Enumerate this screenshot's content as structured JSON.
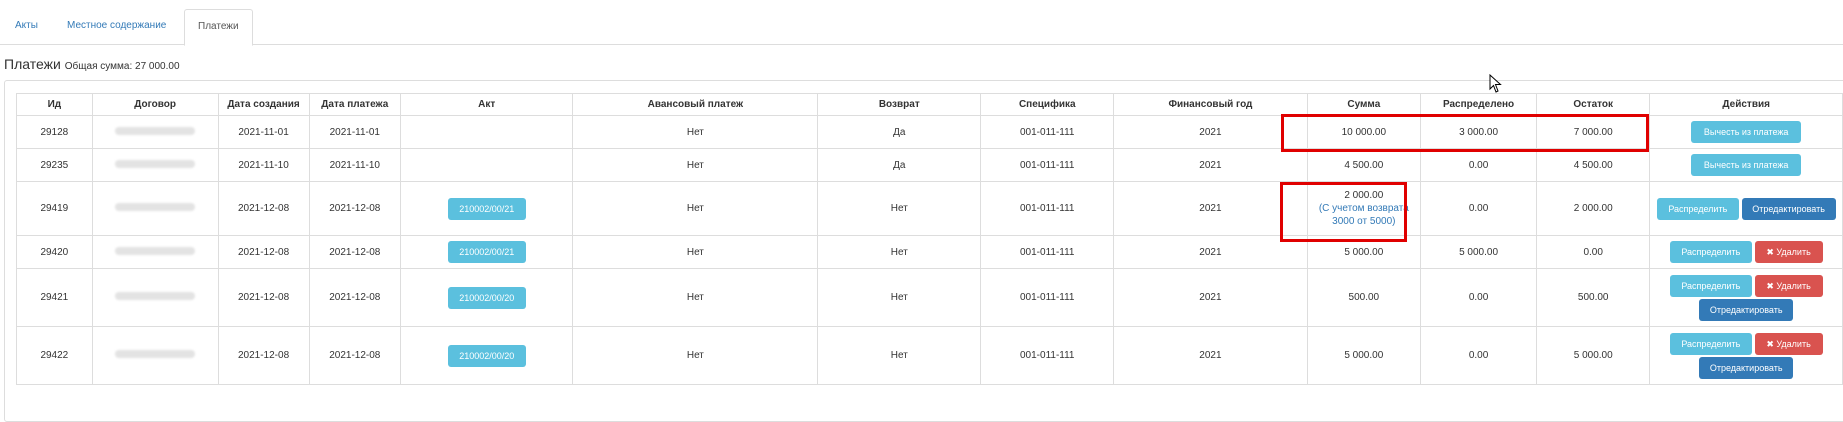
{
  "tabs": [
    {
      "label": "Акты"
    },
    {
      "label": "Местное содержание"
    },
    {
      "label": "Платежи",
      "active": true
    }
  ],
  "section": {
    "title": "Платежи",
    "total_label": "Общая сумма: 27 000.00"
  },
  "table": {
    "headers": [
      "Ид",
      "Договор",
      "Дата создания",
      "Дата платежа",
      "Акт",
      "Авансовый платеж",
      "Возврат",
      "Специфика",
      "Финансовый год",
      "Сумма",
      "Распределено",
      "Остаток",
      "Действия"
    ],
    "rows": [
      {
        "id": "29128",
        "created": "2021-11-01",
        "paid": "2021-11-01",
        "act": "",
        "advance": "Нет",
        "refund": "Да",
        "spec": "001-011-111",
        "year": "2021",
        "sum": "10 000.00",
        "sum_note": "",
        "sum_note2": "",
        "distributed": "3 000.00",
        "remainder": "7 000.00"
      },
      {
        "id": "29235",
        "created": "2021-11-10",
        "paid": "2021-11-10",
        "act": "",
        "advance": "Нет",
        "refund": "Да",
        "spec": "001-011-111",
        "year": "2021",
        "sum": "4 500.00",
        "sum_note": "",
        "sum_note2": "",
        "distributed": "0.00",
        "remainder": "4 500.00"
      },
      {
        "id": "29419",
        "created": "2021-12-08",
        "paid": "2021-12-08",
        "act": "210002/00/21",
        "advance": "Нет",
        "refund": "Нет",
        "spec": "001-011-111",
        "year": "2021",
        "sum": "2 000.00",
        "sum_note": "(С учетом возврата",
        "sum_note2": "3000 от 5000)",
        "distributed": "0.00",
        "remainder": "2 000.00"
      },
      {
        "id": "29420",
        "created": "2021-12-08",
        "paid": "2021-12-08",
        "act": "210002/00/21",
        "advance": "Нет",
        "refund": "Нет",
        "spec": "001-011-111",
        "year": "2021",
        "sum": "5 000.00",
        "sum_note": "",
        "sum_note2": "",
        "distributed": "5 000.00",
        "remainder": "0.00"
      },
      {
        "id": "29421",
        "created": "2021-12-08",
        "paid": "2021-12-08",
        "act": "210002/00/20",
        "advance": "Нет",
        "refund": "Нет",
        "spec": "001-011-111",
        "year": "2021",
        "sum": "500.00",
        "sum_note": "",
        "sum_note2": "",
        "distributed": "0.00",
        "remainder": "500.00"
      },
      {
        "id": "29422",
        "created": "2021-12-08",
        "paid": "2021-12-08",
        "act": "210002/00/20",
        "advance": "Нет",
        "refund": "Нет",
        "spec": "001-011-111",
        "year": "2021",
        "sum": "5 000.00",
        "sum_note": "",
        "sum_note2": "",
        "distributed": "0.00",
        "remainder": "5 000.00"
      }
    ]
  },
  "actions": {
    "deduct": "Вычесть из платежа",
    "distribute": "Распределить",
    "edit": "Отредактировать",
    "delete": "Удалить"
  },
  "colors": {
    "info": "#5bc0de",
    "primary": "#337ab7",
    "danger": "#d9534f",
    "highlight": "#e00000"
  }
}
